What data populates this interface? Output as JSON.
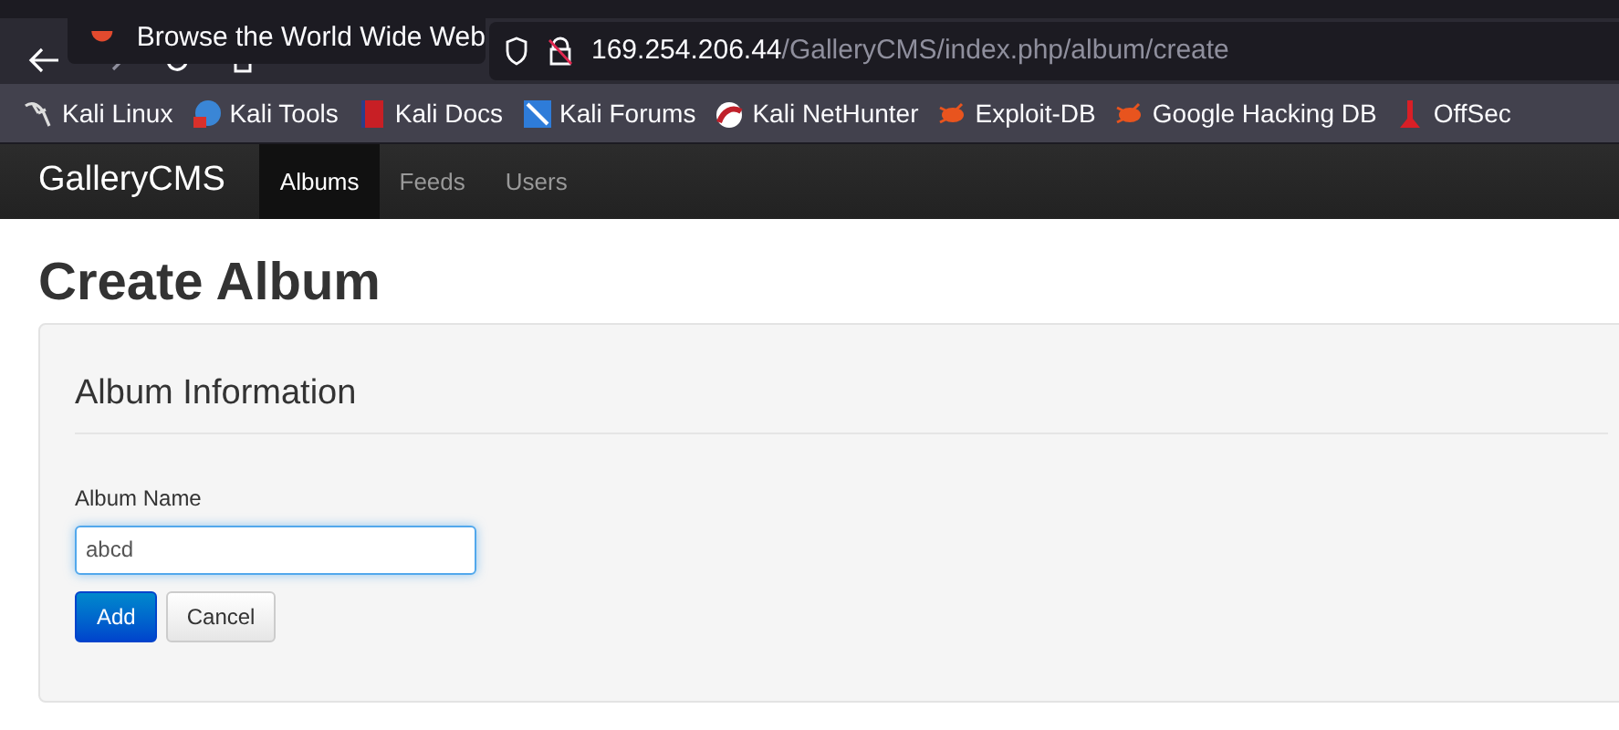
{
  "tooltip": "Browse the World Wide Web",
  "address_bar": {
    "host": "169.254.206.44",
    "path": "/GalleryCMS/index.php/album/create"
  },
  "bookmarks": [
    {
      "label": "Kali Linux",
      "kind": "dragon"
    },
    {
      "label": "Kali Tools",
      "kind": "tools"
    },
    {
      "label": "Kali Docs",
      "kind": "docs"
    },
    {
      "label": "Kali Forums",
      "kind": "forums"
    },
    {
      "label": "Kali NetHunter",
      "kind": "nethunter"
    },
    {
      "label": "Exploit-DB",
      "kind": "bug"
    },
    {
      "label": "Google Hacking DB",
      "kind": "bug"
    },
    {
      "label": "OffSec",
      "kind": "offsec"
    }
  ],
  "navbar": {
    "brand": "GalleryCMS",
    "items": [
      {
        "label": "Albums",
        "selected": true
      },
      {
        "label": "Feeds",
        "selected": false
      },
      {
        "label": "Users",
        "selected": false
      }
    ]
  },
  "heading": "Create Album",
  "form": {
    "legend": "Album Information",
    "field": {
      "label": "Album Name",
      "value": "abcd"
    },
    "buttons": [
      {
        "label": "Add",
        "kind": "primary"
      },
      {
        "label": "Cancel",
        "kind": "default"
      }
    ]
  }
}
